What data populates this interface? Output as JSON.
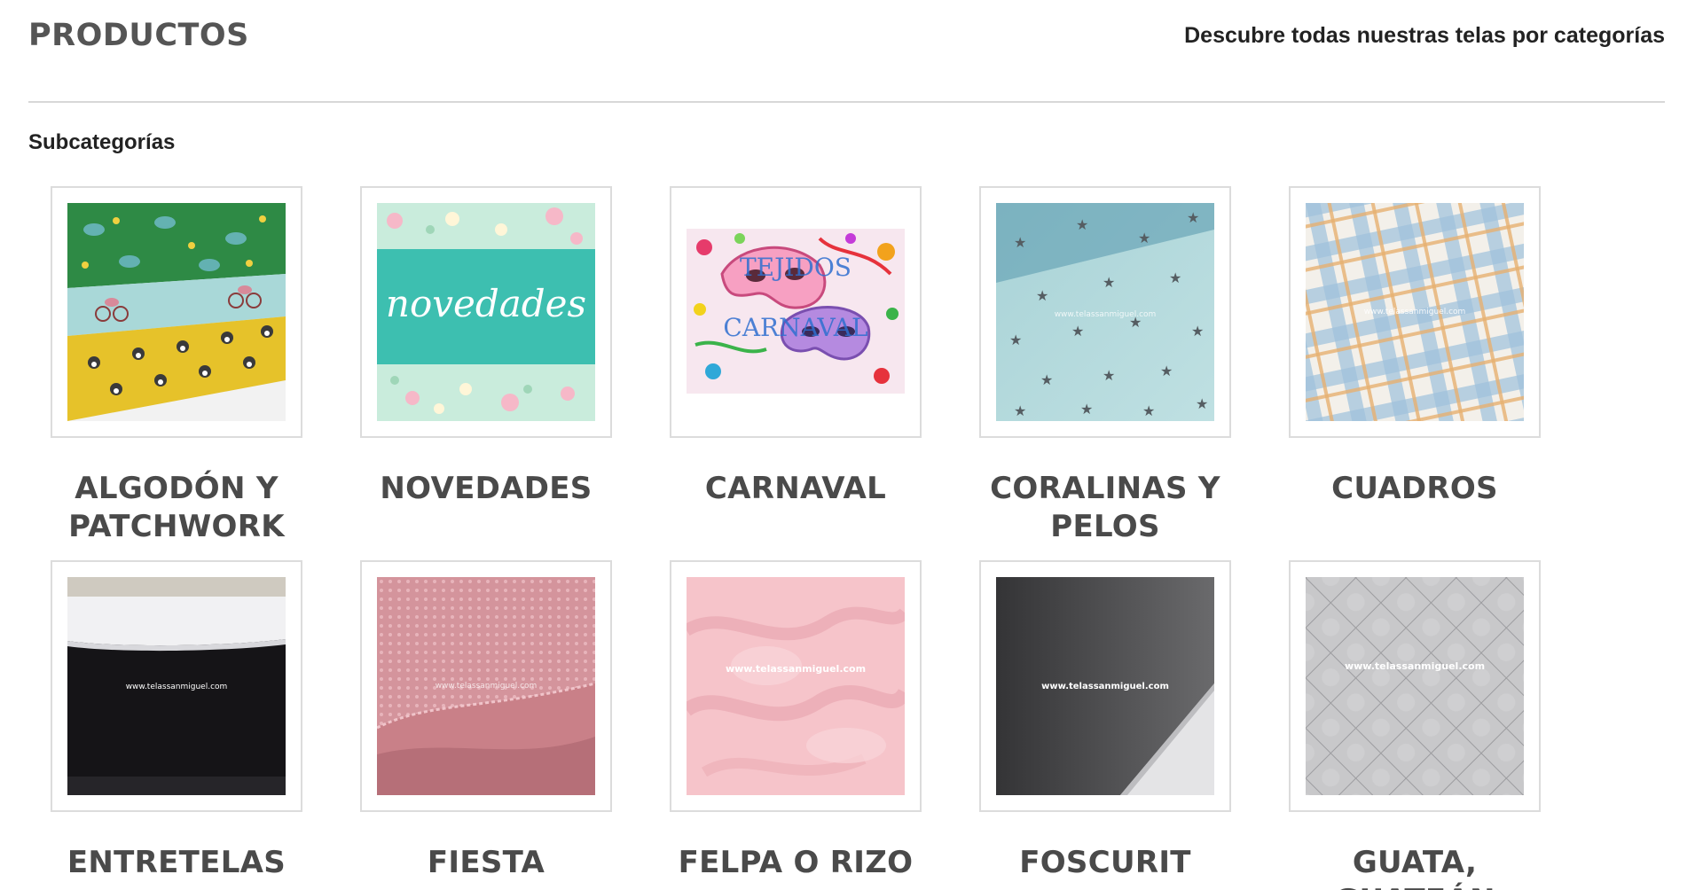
{
  "header": {
    "title": "PRODUCTOS",
    "subtitle": "Descubre todas nuestras telas por categorías"
  },
  "subcategories": {
    "heading": "Subcategorías",
    "items": [
      {
        "name": "ALGODÓN Y PATCHWORK",
        "image": "patchwork-fabric-photo"
      },
      {
        "name": "NOVEDADES",
        "image": "novedades-banner",
        "image_text": "novedades"
      },
      {
        "name": "CARNAVAL",
        "image": "carnival-masks-photo",
        "image_text": "TEJIDOS CARNAVAL"
      },
      {
        "name": "CORALINAS Y PELOS",
        "image": "star-print-fabric-photo",
        "image_text": "www.telassanmiguel.com"
      },
      {
        "name": "CUADROS",
        "image": "plaid-fabric-photo",
        "image_text": "www.telassanmiguel.com"
      },
      {
        "name": "ENTRETELAS",
        "image": "interfacing-fabric-photo",
        "image_text": "www.telassanmiguel.com"
      },
      {
        "name": "FIESTA",
        "image": "pink-lace-fabric-photo",
        "image_text": "www.telassanmiguel.com"
      },
      {
        "name": "FELPA O RIZO",
        "image": "pink-terry-fabric-photo",
        "image_text": "www.telassanmiguel.com"
      },
      {
        "name": "FOSCURIT",
        "image": "grey-blackout-fabric-photo",
        "image_text": "www.telassanmiguel.com"
      },
      {
        "name": "GUATA, GUATEÁN",
        "image": "quilted-fabric-photo",
        "image_text": "www.telassanmiguel.com"
      }
    ]
  },
  "colors": {
    "title": "#555555",
    "card_border": "#dcdcdc",
    "divider": "#d8d8d8",
    "novedades_teal": "#3dbfb0"
  }
}
